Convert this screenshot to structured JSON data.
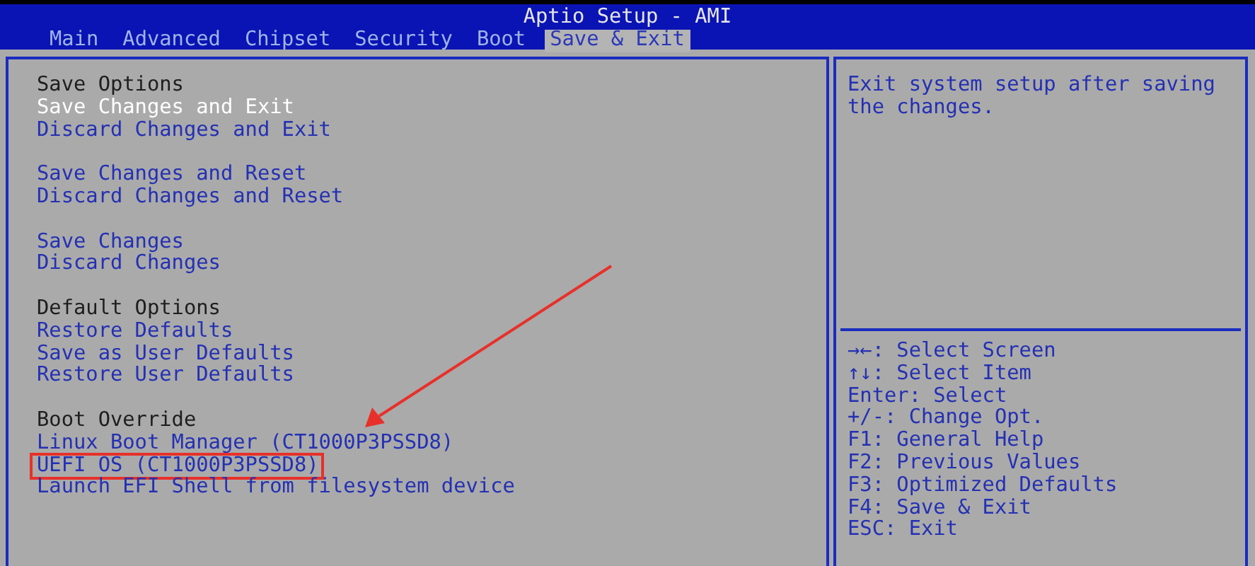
{
  "window": {
    "title": "Aptio Setup - AMI"
  },
  "tabs": [
    {
      "label": "Main",
      "selected": false
    },
    {
      "label": "Advanced",
      "selected": false
    },
    {
      "label": "Chipset",
      "selected": false
    },
    {
      "label": "Security",
      "selected": false
    },
    {
      "label": "Boot",
      "selected": false
    },
    {
      "label": "Save & Exit",
      "selected": true
    }
  ],
  "menu_groups": [
    {
      "heading": "Save Options",
      "items": [
        {
          "label": "Save Changes and Exit",
          "selected": true,
          "annotated": false
        },
        {
          "label": "Discard Changes and Exit",
          "selected": false,
          "annotated": false
        }
      ]
    },
    {
      "items": [
        {
          "label": "Save Changes and Reset",
          "selected": false,
          "annotated": false
        },
        {
          "label": "Discard Changes and Reset",
          "selected": false,
          "annotated": false
        }
      ]
    },
    {
      "items": [
        {
          "label": "Save Changes",
          "selected": false,
          "annotated": false
        },
        {
          "label": "Discard Changes",
          "selected": false,
          "annotated": false
        }
      ]
    },
    {
      "heading": "Default Options",
      "items": [
        {
          "label": "Restore Defaults",
          "selected": false,
          "annotated": false
        },
        {
          "label": "Save as User Defaults",
          "selected": false,
          "annotated": false
        },
        {
          "label": "Restore User Defaults",
          "selected": false,
          "annotated": false
        }
      ]
    },
    {
      "heading": "Boot Override",
      "items": [
        {
          "label": "Linux Boot Manager (CT1000P3PSSD8)",
          "selected": false,
          "annotated": false
        },
        {
          "label": "UEFI OS (CT1000P3PSSD8)",
          "selected": false,
          "annotated": true
        },
        {
          "label": "Launch EFI Shell from filesystem device",
          "selected": false,
          "annotated": false
        }
      ]
    }
  ],
  "help_text": "Exit system setup after saving the changes.",
  "key_help": [
    "→←: Select Screen",
    "↑↓: Select Item",
    "Enter: Select",
    "+/-: Change Opt.",
    "F1: General Help",
    "F2: Previous Values",
    "F3: Optimized Defaults",
    "F4: Save & Exit",
    "ESC: Exit"
  ]
}
